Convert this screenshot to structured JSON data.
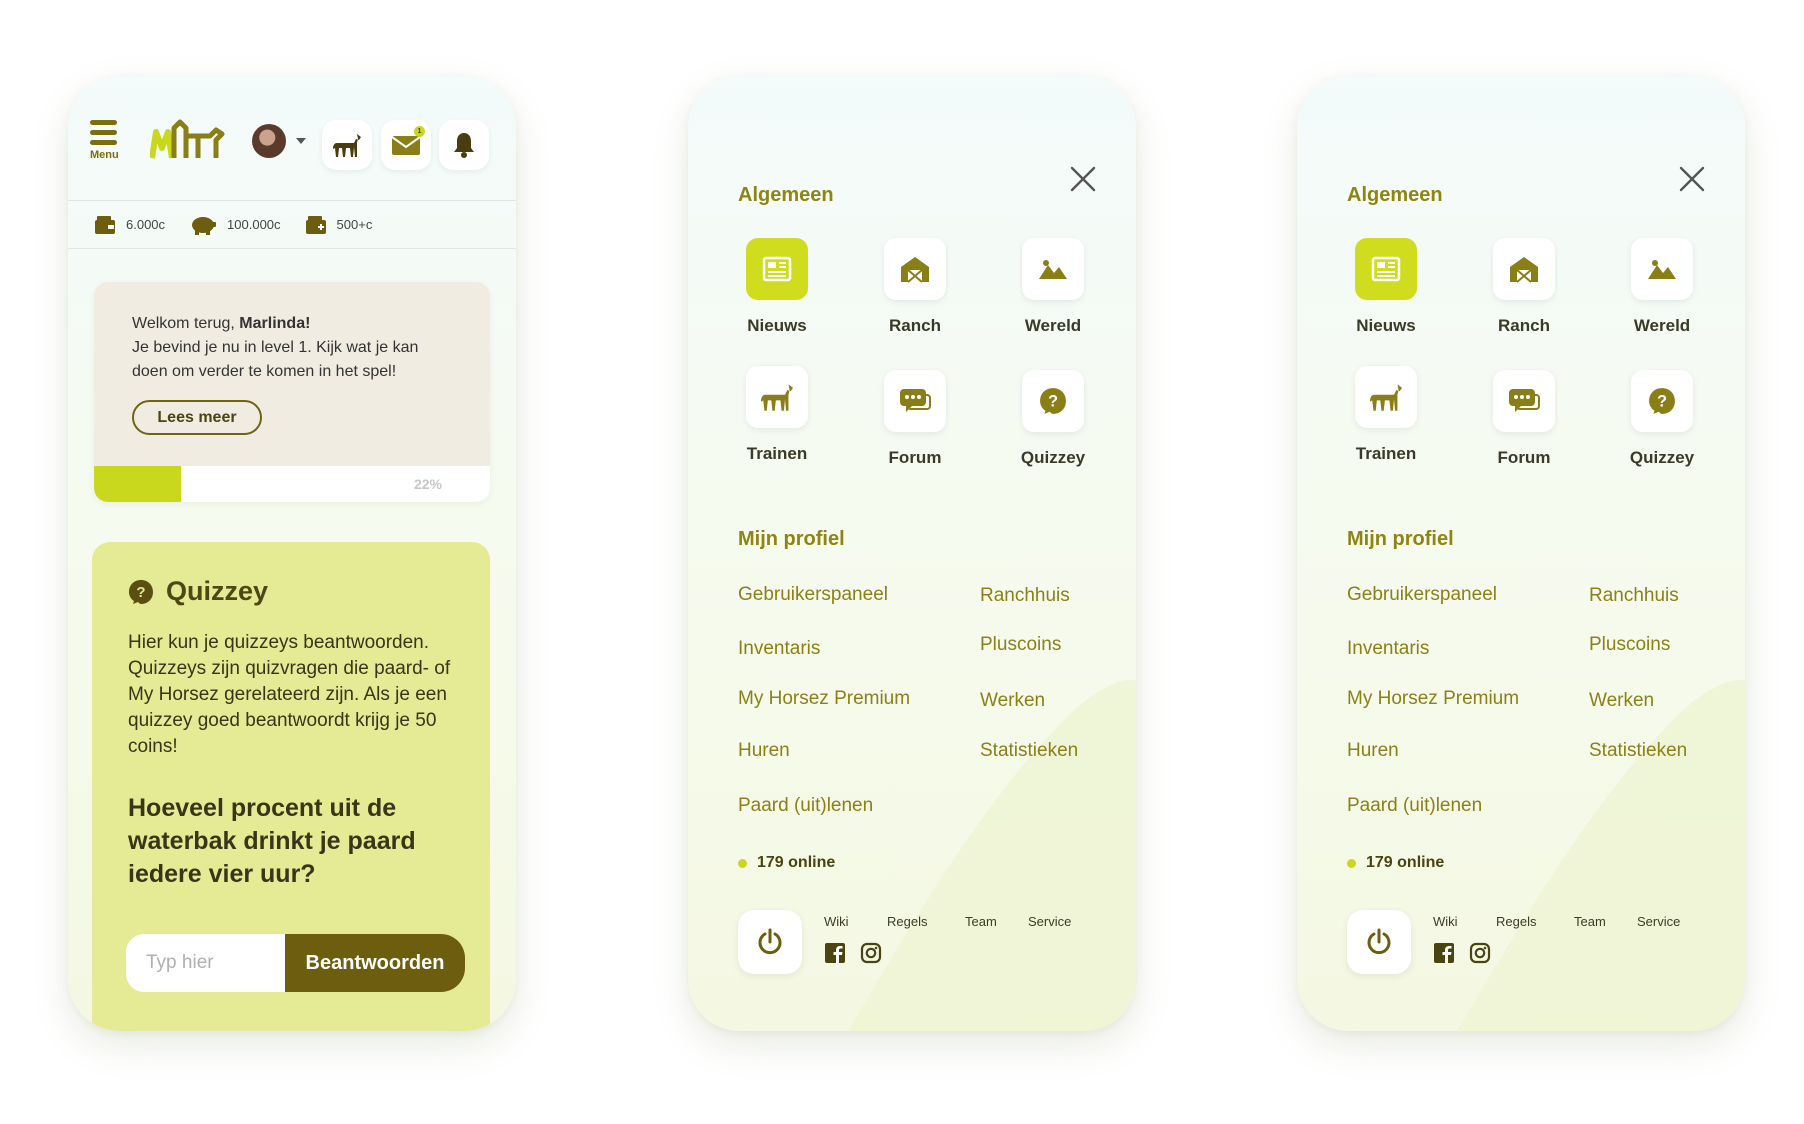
{
  "colors": {
    "accent": "#cfdd1e",
    "brand_dark": "#6d5d0f",
    "olive_text": "#8f8512",
    "quiz_bg": "#e5ea94",
    "card_bg": "#f0ece2"
  },
  "phone1": {
    "header": {
      "menu_label": "Menu",
      "icons": [
        "logo-icon",
        "avatar",
        "horse-icon",
        "mail-icon",
        "bell-icon"
      ],
      "mail_badge": "1"
    },
    "wallet": [
      {
        "icon": "wallet-icon",
        "value": "6.000c"
      },
      {
        "icon": "piggy-bank-icon",
        "value": "100.000c"
      },
      {
        "icon": "wallet-plus-icon",
        "value": "500+c"
      }
    ],
    "welcome": {
      "greeting_prefix": "Welkom terug, ",
      "name": "Marlinda!",
      "message": "Je bevind je nu in level 1. Kijk wat je kan doen om verder te komen in het spel!",
      "button": "Lees meer",
      "progress_value": 22,
      "progress_label": "22%"
    },
    "quiz": {
      "title": "Quizzey",
      "description": "Hier kun je quizzeys beantwoorden. Quizzeys zijn quizvragen die paard- of My Horsez gerelateerd zijn. Als je een quizzey goed beantwoordt krijg je 50 coins!",
      "question": "Hoeveel procent uit de waterbak drinkt je paard iedere vier uur?",
      "input_placeholder": "Typ hier",
      "input_value": "",
      "button": "Beantwoorden"
    }
  },
  "menu": {
    "section_general": "Algemeen",
    "tiles": [
      {
        "label": "Nieuws",
        "icon": "news-icon",
        "active": true
      },
      {
        "label": "Ranch",
        "icon": "ranch-icon",
        "active": false
      },
      {
        "label": "Wereld",
        "icon": "world-icon",
        "active": false
      },
      {
        "label": "Trainen",
        "icon": "horse-icon",
        "active": false
      },
      {
        "label": "Forum",
        "icon": "forum-icon",
        "active": false
      },
      {
        "label": "Quizzey",
        "icon": "question-icon",
        "active": false
      }
    ],
    "section_profile": "Mijn profiel",
    "profile_links": {
      "gebruikerspaneel": "Gebruikerspaneel",
      "ranchhuis": "Ranchhuis",
      "inventaris": "Inventaris",
      "pluscoins": "Pluscoins",
      "premium": "My Horsez Premium",
      "werken": "Werken",
      "huren": "Huren",
      "statistieken": "Statistieken",
      "uitlenen": "Paard (uit)lenen"
    },
    "online": "179 online",
    "footer_links": {
      "wiki": "Wiki",
      "regels": "Regels",
      "team": "Team",
      "service": "Service"
    },
    "footer_icons": [
      "power-icon",
      "facebook-icon",
      "instagram-icon",
      "close-icon"
    ]
  }
}
